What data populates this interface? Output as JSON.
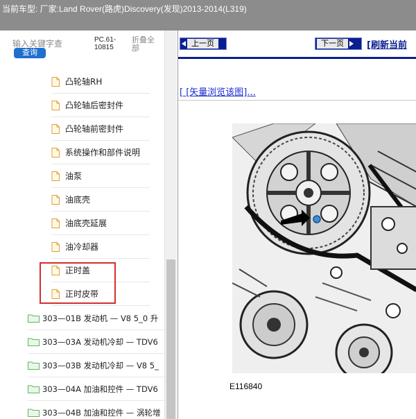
{
  "topbar": {
    "vehicle_text": "当前车型:   厂家:Land Rover(路虎)Discovery(发现)2013-2014(L319)"
  },
  "search": {
    "placeholder": "输入关键字查",
    "button_label": "查询"
  },
  "pc_code": "PC.61-10815",
  "collapse_all_label": "折叠全部",
  "tree": {
    "sub_items": [
      {
        "label": "凸轮轴RH"
      },
      {
        "label": "凸轮轴后密封件"
      },
      {
        "label": "凸轮轴前密封件"
      },
      {
        "label": "系统操作和部件说明"
      },
      {
        "label": "油泵"
      },
      {
        "label": "油底壳"
      },
      {
        "label": "油底壳延展"
      },
      {
        "label": "油冷却器"
      },
      {
        "label": "正时盖"
      },
      {
        "label": "正时皮带"
      }
    ],
    "folders": [
      {
        "label": "303—01B 发动机 — V8 5_0 升"
      },
      {
        "label": "303—03A 发动机冷却 — TDV6"
      },
      {
        "label": "303—03B 发动机冷却 — V8 5_"
      },
      {
        "label": "303—04A 加油和控件 — TDV6"
      },
      {
        "label": "303—04B 加油和控件 — 涡轮增"
      }
    ]
  },
  "content": {
    "prev_label": "上一页",
    "next_label": "下一页",
    "refresh_label": "[刷新当前",
    "vector_link": "[ [矢量浏览该图]...",
    "figure_caption": "E116840"
  },
  "colors": {
    "topbar": "#8c8c8c",
    "nav_button": "#0a1f8f",
    "link": "#1a2bd0",
    "highlight": "#d0302c",
    "folder_icon": "#5cb85c",
    "search_button": "#1f6fce"
  }
}
